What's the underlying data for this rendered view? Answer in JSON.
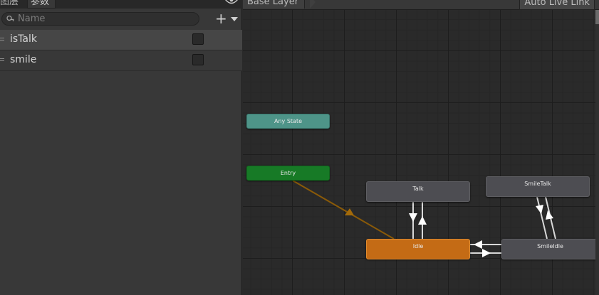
{
  "left_panel": {
    "tabs": {
      "layers": "图层",
      "parameters": "参数"
    },
    "search": {
      "placeholder": "Name"
    },
    "parameters": [
      {
        "name": "isTalk",
        "value": false,
        "selected": true
      },
      {
        "name": "smile",
        "value": false,
        "selected": false
      }
    ]
  },
  "graph": {
    "breadcrumb": "Base Layer",
    "live_link": "Auto Live Link",
    "states": {
      "any_state": "Any State",
      "entry": "Entry",
      "talk": "Talk",
      "smile_talk": "SmileTalk",
      "idle": "Idle",
      "smile_idle": "SmileIdle"
    }
  },
  "colors": {
    "any_state": "#4e9488",
    "entry": "#177a26",
    "default_state": "#c46b15",
    "state": "#4d4d52",
    "entry_transition": "#8a5a08",
    "transition": "#e0e0e0"
  }
}
